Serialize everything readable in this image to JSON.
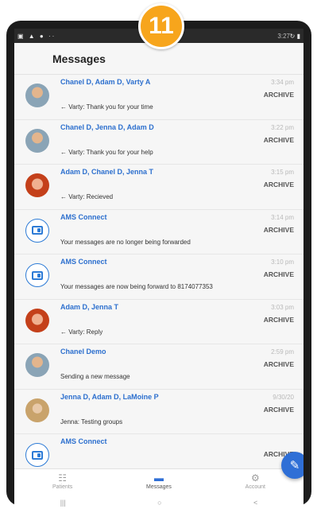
{
  "badge": "11",
  "status_bar": {
    "time": "3:27",
    "icons": "▣ ▲ ● ··",
    "right": "↻ ▮"
  },
  "header": {
    "title": "Messages"
  },
  "conversations": [
    {
      "name": "Chanel D, Adam D, Varty A",
      "preview": "← Varty: Thank you for your time",
      "time": "3:34 pm",
      "action": "ARCHIVE",
      "avatar": "photo"
    },
    {
      "name": "Chanel D, Jenna D, Adam D",
      "preview": "← Varty: Thank you for your help",
      "time": "3:22 pm",
      "action": "ARCHIVE",
      "avatar": "photo"
    },
    {
      "name": "Adam D, Chanel D, Jenna T",
      "preview": "← Varty: Recieved",
      "time": "3:15 pm",
      "action": "ARCHIVE",
      "avatar": "photo"
    },
    {
      "name": "AMS Connect",
      "preview": "Your messages are no longer being forwarded",
      "time": "3:14 pm",
      "action": "ARCHIVE",
      "avatar": "app"
    },
    {
      "name": "AMS Connect",
      "preview": "Your messages are now being forward to 8174077353",
      "time": "3:10 pm",
      "action": "ARCHIVE",
      "avatar": "app"
    },
    {
      "name": "Adam D, Jenna T",
      "preview": "← Varty: Reply",
      "time": "3:03 pm",
      "action": "ARCHIVE",
      "avatar": "photo"
    },
    {
      "name": "Chanel Demo",
      "preview": "Sending a new message",
      "time": "2:59 pm",
      "action": "ARCHIVE",
      "avatar": "photo"
    },
    {
      "name": "Jenna D, Adam D, LaMoine P",
      "preview": "Jenna: Testing groups",
      "time": "9/30/20",
      "action": "ARCHIVE",
      "avatar": "photo"
    },
    {
      "name": "AMS Connect",
      "preview": "",
      "time": "",
      "action": "ARCHIVE",
      "avatar": "app"
    }
  ],
  "fab": {
    "icon": "compose-icon",
    "glyph": "✎"
  },
  "tabs": [
    {
      "label": "Patients",
      "glyph": "☷",
      "active": false
    },
    {
      "label": "Messages",
      "glyph": "▬",
      "active": true
    },
    {
      "label": "Account",
      "glyph": "⚙",
      "active": false
    }
  ],
  "nav": {
    "recent": "|||",
    "home": "○",
    "back": "<"
  }
}
